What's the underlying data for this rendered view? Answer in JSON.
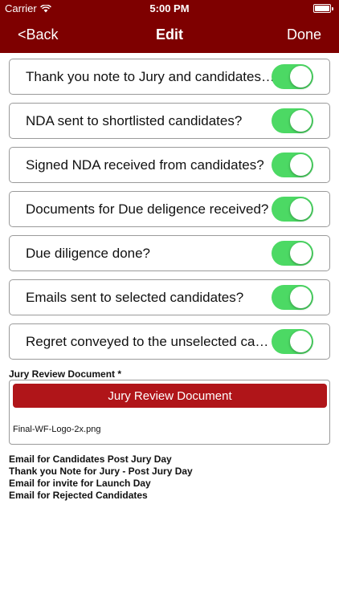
{
  "status_bar": {
    "carrier": "Carrier",
    "time": "5:00 PM",
    "wifi_icon": "wifi-icon",
    "battery_icon": "battery-icon"
  },
  "nav": {
    "back_label": "<Back",
    "title": "Edit",
    "done_label": "Done"
  },
  "checklist": [
    {
      "label": "Thank you note to Jury and candidates sent?",
      "on": true
    },
    {
      "label": "NDA sent to shortlisted candidates?",
      "on": true
    },
    {
      "label": "Signed NDA received from candidates?",
      "on": true
    },
    {
      "label": "Documents for Due deligence received?",
      "on": true
    },
    {
      "label": "Due diligence done?",
      "on": true
    },
    {
      "label": "Emails sent to selected candidates?",
      "on": true
    },
    {
      "label": "Regret conveyed to the unselected candidates?",
      "on": true
    }
  ],
  "jury_review": {
    "section_label": "Jury Review Document *",
    "button_label": "Jury Review Document",
    "file_name": "Final-WF-Logo-2x.png"
  },
  "email_links": [
    "Email for Candidates Post Jury Day",
    "Thank you Note for Jury - Post Jury Day",
    "Email for invite for Launch Day",
    "Email for Rejected Candidates"
  ],
  "colors": {
    "brand_maroon": "#7e0000",
    "button_red": "#b01519",
    "toggle_green": "#4cd964"
  }
}
